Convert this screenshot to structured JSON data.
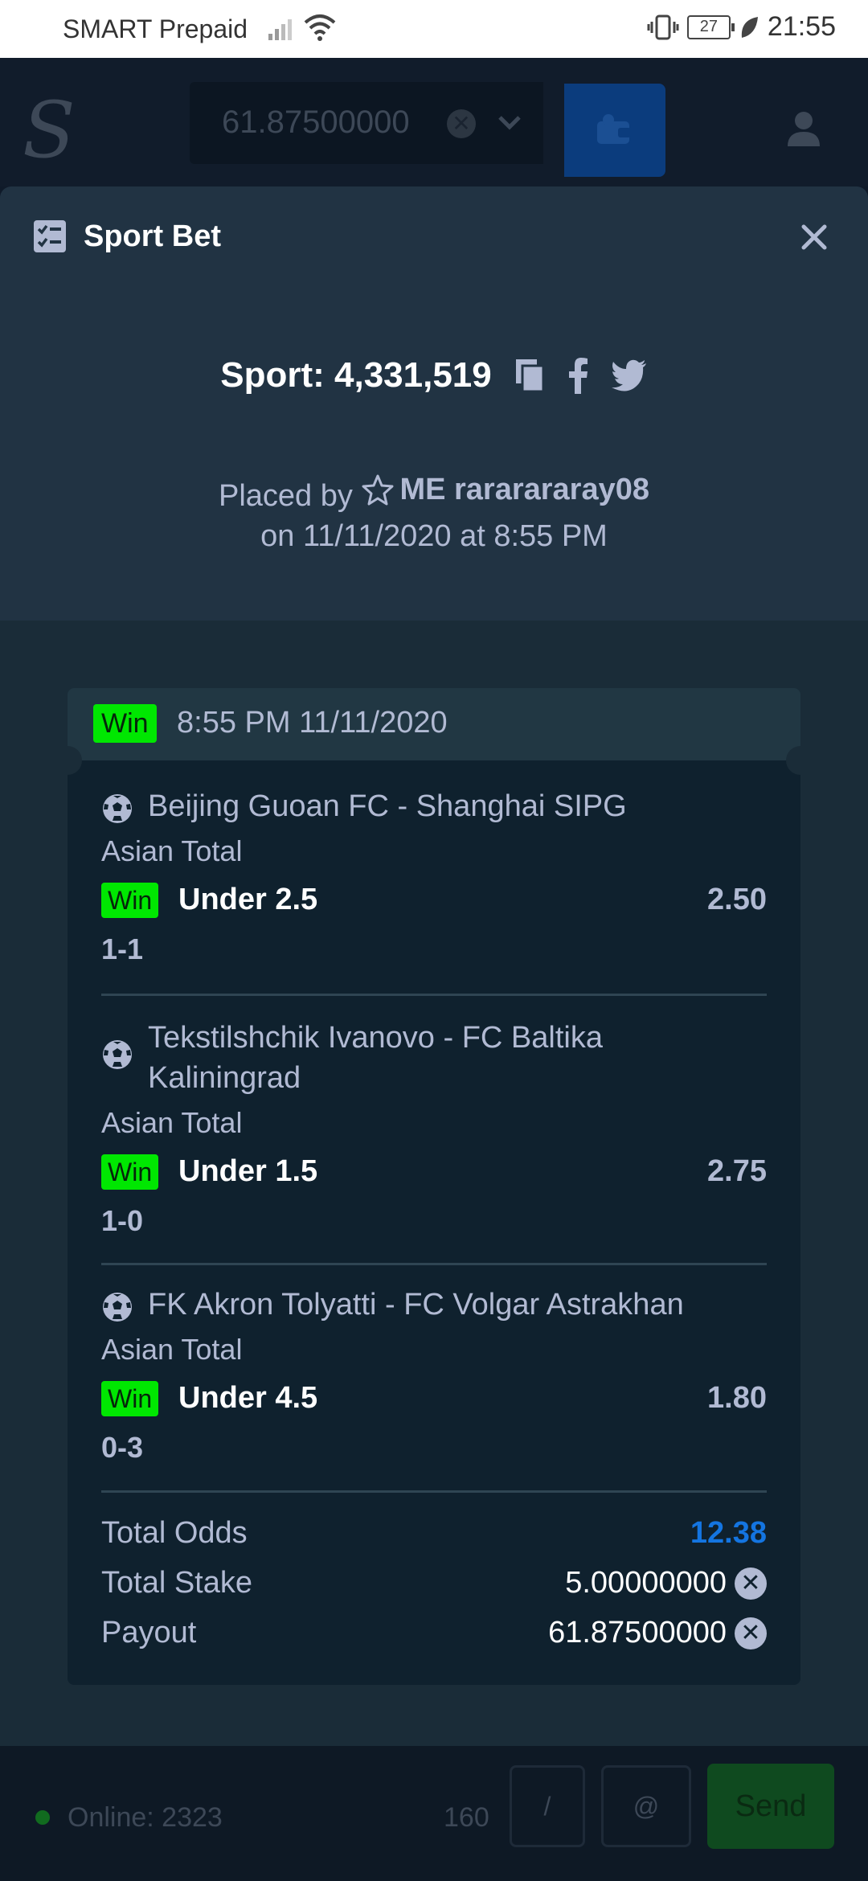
{
  "status_bar": {
    "carrier": "SMART Prepaid",
    "battery": "27",
    "time": "21:55"
  },
  "header": {
    "logo": "S",
    "balance": "61.87500000",
    "coin_symbol": "✕"
  },
  "modal": {
    "title": "Sport Bet",
    "bet_id": "Sport: 4,331,519",
    "placed_by_prefix": "Placed by",
    "user": "ME rararararay08",
    "placed_on": "on 11/11/2020 at 8:55 PM"
  },
  "ticket": {
    "status": "Win",
    "time": "8:55 PM 11/11/2020",
    "legs": [
      {
        "match": "Beijing Guoan FC - Shanghai SIPG",
        "market": "Asian Total",
        "result": "Win",
        "selection": "Under 2.5",
        "odds": "2.50",
        "score": "1-1"
      },
      {
        "match": "Tekstilshchik Ivanovo - FC Baltika Kaliningrad",
        "market": "Asian Total",
        "result": "Win",
        "selection": "Under 1.5",
        "odds": "2.75",
        "score": "1-0"
      },
      {
        "match": "FK Akron Tolyatti - FC Volgar Astrakhan",
        "market": "Asian Total",
        "result": "Win",
        "selection": "Under 4.5",
        "odds": "1.80",
        "score": "0-3"
      }
    ],
    "summary": {
      "total_odds_label": "Total Odds",
      "total_odds": "12.38",
      "total_stake_label": "Total Stake",
      "total_stake": "5.00000000",
      "payout_label": "Payout",
      "payout": "61.87500000"
    }
  },
  "footer": {
    "online": "Online: 2323",
    "char_count": "160",
    "slash": "/",
    "at": "@",
    "send": "Send"
  },
  "colors": {
    "win_green": "#00e701",
    "accent_blue": "#1475e1",
    "modal_bg": "#213343"
  }
}
